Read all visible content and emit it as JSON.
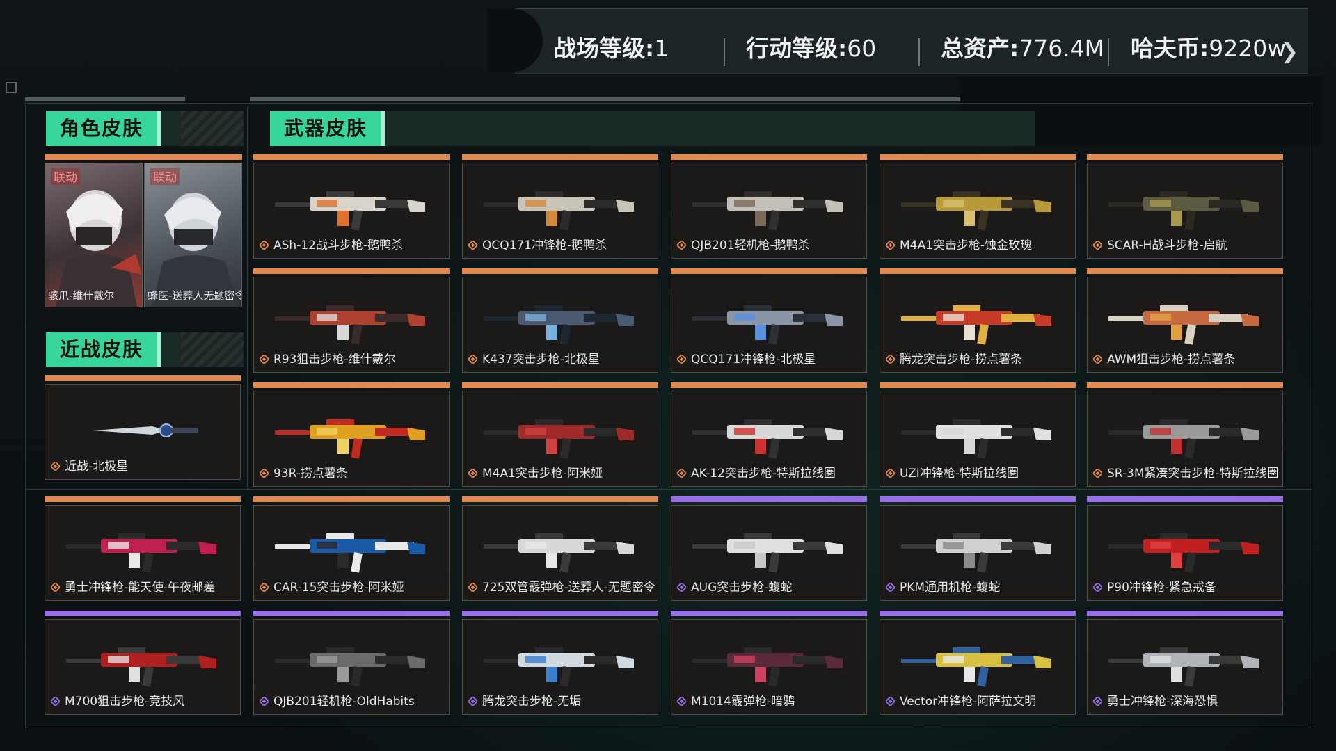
{
  "header": {
    "stats": [
      {
        "label": "战场等级:",
        "value": "1"
      },
      {
        "label": "行动等级:",
        "value": "60"
      },
      {
        "label": "总资产:",
        "value": "776.4M"
      },
      {
        "label": "哈夫币:",
        "value": "9220w"
      }
    ],
    "next_icon": "chevron-right-icon"
  },
  "sections": {
    "role": "角色皮肤",
    "melee": "近战皮肤",
    "weapon": "武器皮肤"
  },
  "role_skins": [
    {
      "tag": "联动",
      "name": "骇爪-维什戴尔"
    },
    {
      "tag": "联动",
      "name": "蜂医-送葬人无题密令"
    }
  ],
  "colors": {
    "orange": "#e2894f",
    "purple": "#9a6ee8",
    "accent": "#37d59a"
  },
  "melee_skins": [
    {
      "name": "近战-北极星",
      "rarity": "orange"
    }
  ],
  "weapon_skins": [
    {
      "name": "ASh-12战斗步枪-鹅鸭杀",
      "rarity": "orange"
    },
    {
      "name": "QCQ171冲锋枪-鹅鸭杀",
      "rarity": "orange"
    },
    {
      "name": "QJB201轻机枪-鹅鸭杀",
      "rarity": "orange"
    },
    {
      "name": "M4A1突击步枪-蚀金玫瑰",
      "rarity": "orange"
    },
    {
      "name": "SCAR-H战斗步枪-启航",
      "rarity": "orange"
    },
    {
      "name": "R93狙击步枪-维什戴尔",
      "rarity": "orange"
    },
    {
      "name": "K437突击步枪-北极星",
      "rarity": "orange"
    },
    {
      "name": "QCQ171冲锋枪-北极星",
      "rarity": "orange"
    },
    {
      "name": "腾龙突击步枪-捞点薯条",
      "rarity": "orange"
    },
    {
      "name": "AWM狙击步枪-捞点薯条",
      "rarity": "orange"
    },
    {
      "name": "93R-捞点薯条",
      "rarity": "orange"
    },
    {
      "name": "M4A1突击步枪-阿米娅",
      "rarity": "orange"
    },
    {
      "name": "AK-12突击步枪-特斯拉线圈",
      "rarity": "orange"
    },
    {
      "name": "UZI冲锋枪-特斯拉线圈",
      "rarity": "orange"
    },
    {
      "name": "SR-3M紧凑突击步枪-特斯拉线圈",
      "rarity": "orange"
    },
    {
      "name": "勇士冲锋枪-能天使-午夜邮差",
      "rarity": "orange"
    },
    {
      "name": "CAR-15突击步枪-阿米娅",
      "rarity": "orange"
    },
    {
      "name": "725双管霰弹枪-送葬人-无题密令",
      "rarity": "orange"
    },
    {
      "name": "AUG突击步枪-蝮蛇",
      "rarity": "purple"
    },
    {
      "name": "PKM通用机枪-蝮蛇",
      "rarity": "purple"
    },
    {
      "name": "P90冲锋枪-紧急戒备",
      "rarity": "purple"
    },
    {
      "name": "M700狙击步枪-竞技风",
      "rarity": "purple"
    },
    {
      "name": "QJB201轻机枪-OldHabits",
      "rarity": "purple"
    },
    {
      "name": "腾龙突击步枪-无垢",
      "rarity": "purple"
    },
    {
      "name": "M1014霰弹枪-暗鸦",
      "rarity": "purple"
    },
    {
      "name": "Vector冲锋枪-阿萨拉文明",
      "rarity": "purple"
    },
    {
      "name": "勇士冲锋枪-深海恐惧",
      "rarity": "purple"
    }
  ]
}
